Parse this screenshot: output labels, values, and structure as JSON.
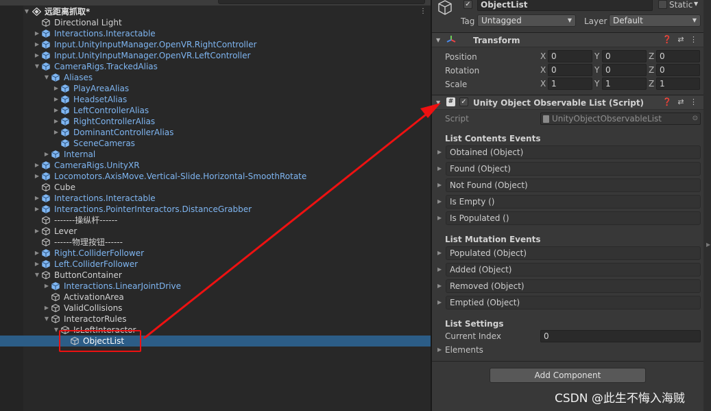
{
  "hierarchy": {
    "scene_name": "远距离抓取*",
    "items": [
      {
        "label": "Directional Light",
        "depth": 0,
        "expander": "",
        "prefab": false
      },
      {
        "label": "Interactions.Interactable",
        "depth": 0,
        "expander": "collapsed",
        "prefab": true
      },
      {
        "label": "Input.UnityInputManager.OpenVR.RightController",
        "depth": 0,
        "expander": "collapsed",
        "prefab": true
      },
      {
        "label": "Input.UnityInputManager.OpenVR.LeftController",
        "depth": 0,
        "expander": "collapsed",
        "prefab": true
      },
      {
        "label": "CameraRigs.TrackedAlias",
        "depth": 0,
        "expander": "expanded",
        "prefab": true
      },
      {
        "label": "Aliases",
        "depth": 1,
        "expander": "expanded",
        "prefab": true
      },
      {
        "label": "PlayAreaAlias",
        "depth": 2,
        "expander": "collapsed",
        "prefab": true
      },
      {
        "label": "HeadsetAlias",
        "depth": 2,
        "expander": "collapsed",
        "prefab": true
      },
      {
        "label": "LeftControllerAlias",
        "depth": 2,
        "expander": "collapsed",
        "prefab": true
      },
      {
        "label": "RightControllerAlias",
        "depth": 2,
        "expander": "collapsed",
        "prefab": true
      },
      {
        "label": "DominantControllerAlias",
        "depth": 2,
        "expander": "collapsed",
        "prefab": true
      },
      {
        "label": "SceneCameras",
        "depth": 2,
        "expander": "",
        "prefab": true
      },
      {
        "label": "Internal",
        "depth": 1,
        "expander": "collapsed",
        "prefab": true
      },
      {
        "label": "CameraRigs.UnityXR",
        "depth": 0,
        "expander": "collapsed",
        "prefab": true
      },
      {
        "label": "Locomotors.AxisMove.Vertical-Slide.Horizontal-SmoothRotate",
        "depth": 0,
        "expander": "collapsed",
        "prefab": true
      },
      {
        "label": "Cube",
        "depth": 0,
        "expander": "",
        "prefab": false
      },
      {
        "label": "Interactions.Interactable",
        "depth": 0,
        "expander": "collapsed",
        "prefab": true
      },
      {
        "label": "Interactions.PointerInteractors.DistanceGrabber",
        "depth": 0,
        "expander": "collapsed",
        "prefab": true
      },
      {
        "label": "-------操纵杆------",
        "depth": 0,
        "expander": "",
        "prefab": false
      },
      {
        "label": "Lever",
        "depth": 0,
        "expander": "collapsed",
        "prefab": false
      },
      {
        "label": "------物理按钮------",
        "depth": 0,
        "expander": "",
        "prefab": false
      },
      {
        "label": "Right.ColliderFollower",
        "depth": 0,
        "expander": "collapsed",
        "prefab": true
      },
      {
        "label": "Left.ColliderFollower",
        "depth": 0,
        "expander": "collapsed",
        "prefab": true
      },
      {
        "label": "ButtonContainer",
        "depth": 0,
        "expander": "expanded",
        "prefab": false
      },
      {
        "label": "Interactions.LinearJointDrive",
        "depth": 1,
        "expander": "collapsed",
        "prefab": true
      },
      {
        "label": "ActivationArea",
        "depth": 1,
        "expander": "",
        "prefab": false
      },
      {
        "label": "ValidCollisions",
        "depth": 1,
        "expander": "collapsed",
        "prefab": false
      },
      {
        "label": "InteractorRules",
        "depth": 1,
        "expander": "expanded",
        "prefab": false
      },
      {
        "label": "IsLeftInteractor",
        "depth": 2,
        "expander": "expanded",
        "prefab": false
      },
      {
        "label": "ObjectList",
        "depth": 3,
        "expander": "",
        "prefab": false,
        "selected": true
      }
    ]
  },
  "inspector": {
    "object_name": "ObjectList",
    "static_label": "Static",
    "tag_label": "Tag",
    "tag_value": "Untagged",
    "layer_label": "Layer",
    "layer_value": "Default",
    "transform": {
      "title": "Transform",
      "position_label": "Position",
      "rotation_label": "Rotation",
      "scale_label": "Scale",
      "axis_x": "X",
      "axis_y": "Y",
      "axis_z": "Z",
      "position": [
        "0",
        "0",
        "0"
      ],
      "rotation": [
        "0",
        "0",
        "0"
      ],
      "scale": [
        "1",
        "1",
        "1"
      ]
    },
    "script_component": {
      "title": "Unity Object Observable List (Script)",
      "script_label": "Script",
      "script_value": "UnityObjectObservableList",
      "contents_section": "List Contents Events",
      "contents_events": [
        "Obtained (Object)",
        "Found (Object)",
        "Not Found (Object)",
        "Is Empty ()",
        "Is Populated ()"
      ],
      "mutation_section": "List Mutation Events",
      "mutation_events": [
        "Populated (Object)",
        "Added (Object)",
        "Removed (Object)",
        "Emptied (Object)"
      ],
      "settings_section": "List Settings",
      "current_index_label": "Current Index",
      "current_index_value": "0",
      "elements_label": "Elements"
    },
    "add_component_label": "Add Component"
  },
  "watermark": "CSDN @此生不悔入海贼",
  "annotation_color": "#ee1111",
  "selection_color": "#2c5d87",
  "prefab_text_color": "#7fb6f2"
}
